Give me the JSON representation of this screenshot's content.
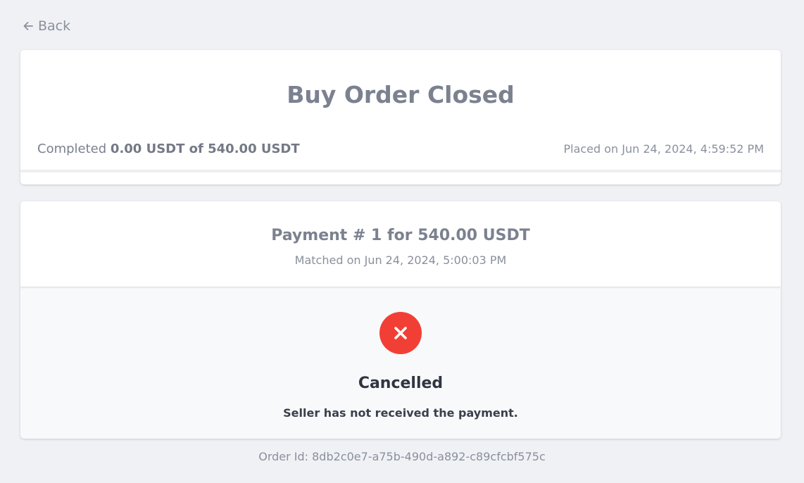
{
  "nav": {
    "back_label": "Back"
  },
  "order": {
    "title": "Buy Order Closed",
    "completed_prefix": "Completed",
    "completed_amount": "0.00 USDT of 540.00 USDT",
    "placed_on": "Placed on Jun 24, 2024, 4:59:52 PM"
  },
  "payment": {
    "title": "Payment # 1 for 540.00 USDT",
    "matched_on": "Matched on Jun 24, 2024, 5:00:03 PM",
    "status_icon": "cancel-icon",
    "status_label": "Cancelled",
    "status_message": "Seller has not received the payment."
  },
  "footer": {
    "order_id": "Order Id: 8db2c0e7-a75b-490d-a892-c89cfcbf575c"
  },
  "colors": {
    "background": "#eff1f5",
    "status_red": "#f23f35"
  }
}
